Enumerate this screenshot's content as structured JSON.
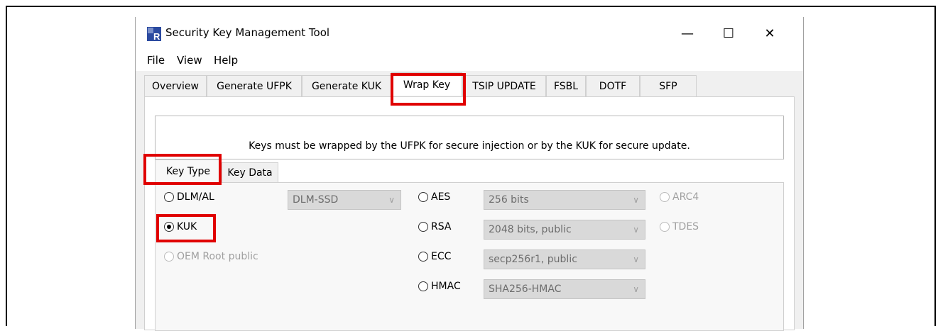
{
  "window": {
    "title": "Security Key Management Tool",
    "minimize": "—",
    "maximize": "☐",
    "close": "✕"
  },
  "menu": [
    "File",
    "View",
    "Help"
  ],
  "tabs": [
    "Overview",
    "Generate UFPK",
    "Generate KUK",
    "Wrap Key",
    "TSIP UPDATE",
    "FSBL",
    "DOTF",
    "SFP"
  ],
  "active_tab": "Wrap Key",
  "hint": "Keys must be wrapped by the UFPK for secure injection or by the KUK for secure update.",
  "subtabs": [
    "Key Type",
    "Key Data"
  ],
  "active_subtab": "Key Type",
  "key_source": {
    "dlm_al": "DLM/AL",
    "dlm_combo": "DLM-SSD",
    "kuk": "KUK",
    "oem_root": "OEM Root public"
  },
  "algorithms": {
    "aes": "AES",
    "aes_value": "256 bits",
    "rsa": "RSA",
    "rsa_value": "2048 bits, public",
    "ecc": "ECC",
    "ecc_value": "secp256r1, public",
    "hmac": "HMAC",
    "hmac_value": "SHA256-HMAC",
    "arc4": "ARC4",
    "tdes": "TDES"
  },
  "colors": {
    "highlight": "#e00000"
  },
  "icons": {
    "app": "renesas-r-icon",
    "chevron": "chevron-down-icon"
  }
}
